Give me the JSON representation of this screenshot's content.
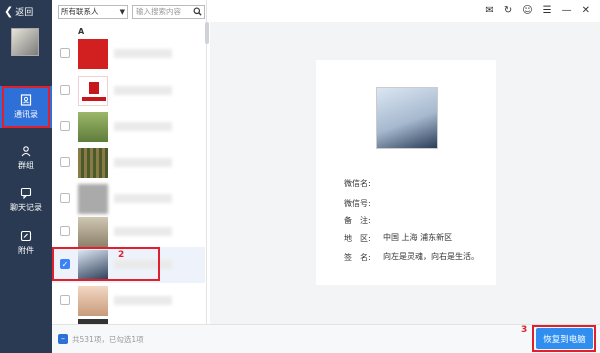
{
  "sidebar": {
    "back_label": "返回",
    "nav": [
      {
        "label": "通讯录",
        "icon": "contacts-icon"
      },
      {
        "label": "群组",
        "icon": "group-icon"
      },
      {
        "label": "聊天记录",
        "icon": "chat-icon"
      },
      {
        "label": "附件",
        "icon": "attachment-icon"
      }
    ]
  },
  "filters": {
    "dropdown_value": "所有联系人",
    "search_placeholder": "输入搜索内容"
  },
  "list": {
    "section_letter": "A"
  },
  "annotations": {
    "num1": "1",
    "num2": "2",
    "num3": "3"
  },
  "detail": {
    "wechat_name_label": "微信名:",
    "wechat_id_label": "微信号:",
    "remark_label": "备　注:",
    "region_label": "地　区:",
    "region_value": "中国 上海 浦东新区",
    "signature_label": "签　名:",
    "signature_value": "向左是灵魂，向右是生活。"
  },
  "footer": {
    "count_text": "共531项，已勾选1项",
    "recover_label": "恢复到电脑"
  },
  "colors": {
    "sidebar_bg": "#2a3a52",
    "accent": "#2f6fd8",
    "highlight": "#e0202c",
    "button": "#2f8ef0"
  }
}
